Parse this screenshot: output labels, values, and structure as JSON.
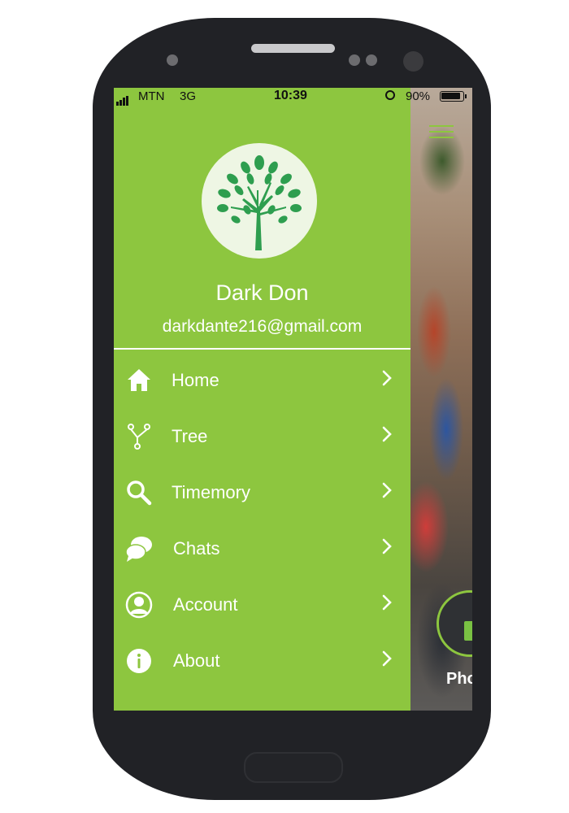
{
  "status_bar": {
    "carrier": "MTN",
    "network": "3G",
    "time": "10:39",
    "battery": "90%",
    "battery_level": 0.9
  },
  "drawer": {
    "user_name": "Dark Don",
    "user_email": "darkdante216@gmail.com",
    "menu": [
      {
        "label": "Home",
        "icon": "home-icon"
      },
      {
        "label": "Tree",
        "icon": "tree-branch-icon"
      },
      {
        "label": "Timemory",
        "icon": "search-icon"
      },
      {
        "label": "Chats",
        "icon": "chat-bubbles-icon"
      },
      {
        "label": "Account",
        "icon": "user-circle-icon"
      },
      {
        "label": "About",
        "icon": "info-icon"
      }
    ]
  },
  "background": {
    "fab_label": "Pho"
  },
  "colors": {
    "accent": "#8dc63f",
    "logo_tree": "#2e9e4f",
    "phone_body": "#212226"
  }
}
